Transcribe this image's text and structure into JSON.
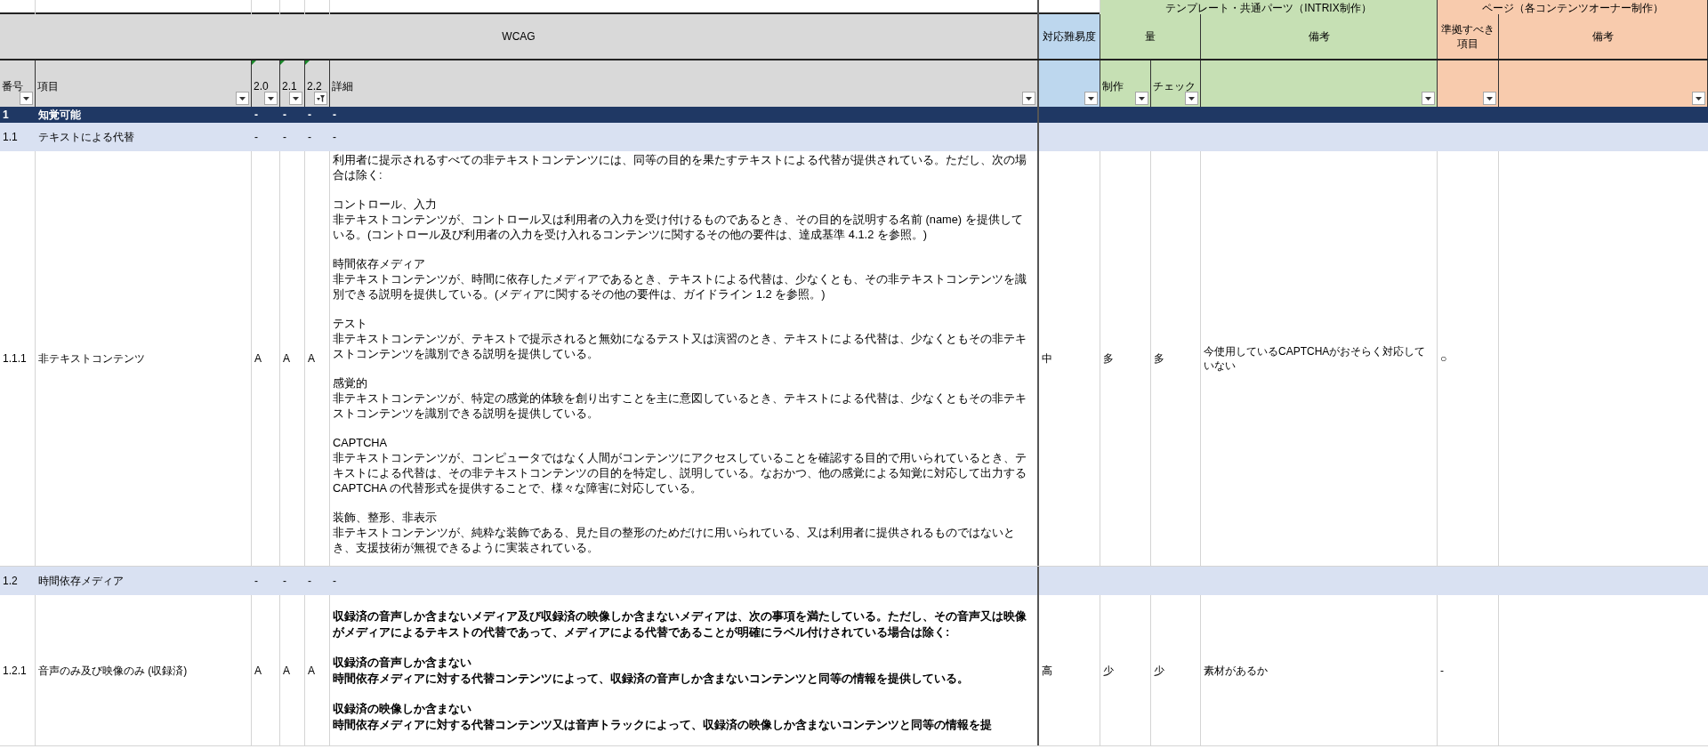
{
  "group_headers": [
    {
      "kind": "template",
      "label": "テンプレート・共通パーツ（INTRIX制作）"
    },
    {
      "kind": "page",
      "label": "ページ（各コンテンツオーナー制作）"
    }
  ],
  "header_top": {
    "wcag": "WCAG",
    "difficulty": "対応難易度",
    "amount": "量",
    "template_notes": "備考",
    "should_comply": "準拠すべき項目",
    "page_notes": "備考"
  },
  "columns": [
    {
      "label": "番号",
      "filtered": false,
      "comment": false
    },
    {
      "label": "項目",
      "filtered": false,
      "comment": false
    },
    {
      "label": "2.0",
      "filtered": false,
      "comment": true
    },
    {
      "label": "2.1",
      "filtered": false,
      "comment": true
    },
    {
      "label": "2.2",
      "filtered": true,
      "comment": true
    },
    {
      "label": "詳細",
      "filtered": false,
      "comment": false
    },
    {
      "filtered": false,
      "comment": false
    },
    {
      "label": "制作",
      "filtered": false,
      "comment": false
    },
    {
      "label": "チェック",
      "filtered": false,
      "comment": false
    },
    {
      "filtered": false,
      "comment": false
    },
    {
      "filtered": false,
      "comment": false
    },
    {
      "filtered": false,
      "comment": false
    }
  ],
  "rows": [
    {
      "kind": "section",
      "number": "1",
      "item": "知覚可能",
      "levels": [
        "-",
        "-",
        "-"
      ],
      "detail": [
        {
          "body": "-"
        }
      ]
    },
    {
      "kind": "guideline",
      "number": "1.1",
      "item": "テキストによる代替",
      "levels": [
        "-",
        "-",
        "-"
      ],
      "detail": [
        {
          "body": "-"
        }
      ]
    },
    {
      "kind": "criterion",
      "number": "1.1.1",
      "item": "非テキストコンテンツ",
      "levels": [
        "A",
        "A",
        "A"
      ],
      "detail_bold": false,
      "detail": [
        {
          "body": "利用者に提示されるすべての非テキストコンテンツには、同等の目的を果たすテキストによる代替が提供されている。ただし、次の場合は除く:"
        },
        {
          "heading": "コントロール、入力",
          "body": "非テキストコンテンツが、コントロール又は利用者の入力を受け付けるものであるとき、その目的を説明する名前 (name) を提供している。(コントロール及び利用者の入力を受け入れるコンテンツに関するその他の要件は、達成基準 4.1.2 を参照。)"
        },
        {
          "heading": "時間依存メディア",
          "body": "非テキストコンテンツが、時間に依存したメディアであるとき、テキストによる代替は、少なくとも、その非テキストコンテンツを識別できる説明を提供している。(メディアに関するその他の要件は、ガイドライン 1.2 を参照。)"
        },
        {
          "heading": "テスト",
          "body": "非テキストコンテンツが、テキストで提示されると無効になるテスト又は演習のとき、テキストによる代替は、少なくともその非テキストコンテンツを識別できる説明を提供している。"
        },
        {
          "heading": "感覚的",
          "body": "非テキストコンテンツが、特定の感覚的体験を創り出すことを主に意図しているとき、テキストによる代替は、少なくともその非テキストコンテンツを識別できる説明を提供している。"
        },
        {
          "heading": "CAPTCHA",
          "body": "非テキストコンテンツが、コンピュータではなく人間がコンテンツにアクセスしていることを確認する目的で用いられているとき、テキストによる代替は、その非テキストコンテンツの目的を特定し、説明している。なおかつ、他の感覚による知覚に対応して出力する CAPTCHA の代替形式を提供することで、様々な障害に対応している。"
        },
        {
          "heading": "装飾、整形、非表示",
          "body": "非テキストコンテンツが、純粋な装飾である、見た目の整形のためだけに用いられている、又は利用者に提供されるものではないとき、支援技術が無視できるように実装されている。"
        }
      ],
      "difficulty": "中",
      "production": "多",
      "check": "多",
      "template_notes": "今使用しているCAPTCHAがおそらく対応していない",
      "should_comply": "○"
    },
    {
      "kind": "guideline",
      "number": "1.2",
      "item": "時間依存メディア",
      "levels": [
        "-",
        "-",
        "-"
      ],
      "detail": [
        {
          "body": "-"
        }
      ]
    },
    {
      "kind": "criterion",
      "number": "1.2.1",
      "item": "音声のみ及び映像のみ (収録済)",
      "levels": [
        "A",
        "A",
        "A"
      ],
      "detail_bold": true,
      "detail": [
        {
          "body": "収録済の音声しか含まないメディア及び収録済の映像しか含まないメディアは、次の事項を満たしている。ただし、その音声又は映像がメディアによるテキストの代替であって、メディアによる代替であることが明確にラベル付けされている場合は除く:"
        },
        {
          "heading": "収録済の音声しか含まない",
          "body": "時間依存メディアに対する代替コンテンツによって、収録済の音声しか含まないコンテンツと同等の情報を提供している。"
        },
        {
          "heading": "収録済の映像しか含まない",
          "body": "時間依存メディアに対する代替コンテンツ又は音声トラックによって、収録済の映像しか含まないコンテンツと同等の情報を提"
        }
      ],
      "difficulty": "高",
      "production": "少",
      "check": "少",
      "template_notes": "素材があるか",
      "should_comply": "-"
    }
  ]
}
